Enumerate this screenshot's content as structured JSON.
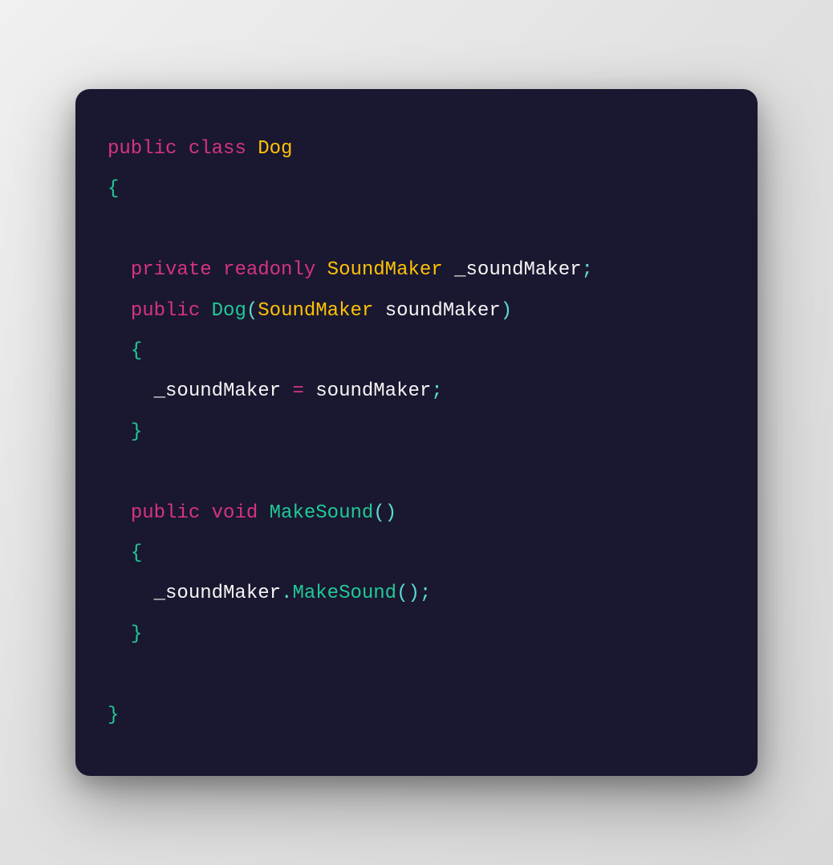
{
  "colors": {
    "background": "#1a1830",
    "keyword": "#d63384",
    "type": "#ffc107",
    "method": "#20c997",
    "brace": "#20c997",
    "punct": "#5cdbd3",
    "ident": "#f5f5f5"
  },
  "code": {
    "line1": {
      "kw_public": "public",
      "kw_class": "class",
      "type_dog": "Dog"
    },
    "line2": {
      "brace": "{"
    },
    "line3": {
      "spacer": ""
    },
    "line4": {
      "kw_private": "private",
      "kw_readonly": "readonly",
      "type_sm": "SoundMaker",
      "field": "_soundMaker",
      "semi": ";"
    },
    "line5": {
      "kw_public": "public",
      "ctor": "Dog",
      "lparen": "(",
      "param_type": "SoundMaker",
      "param_name": "soundMaker",
      "rparen": ")"
    },
    "line6": {
      "brace": "{"
    },
    "line7": {
      "lhs": "_soundMaker",
      "op": "=",
      "rhs": "soundMaker",
      "semi": ";"
    },
    "line8": {
      "brace": "}"
    },
    "line9": {
      "spacer": ""
    },
    "line10": {
      "kw_public": "public",
      "kw_void": "void",
      "method": "MakeSound",
      "lparen": "(",
      "rparen": ")"
    },
    "line11": {
      "brace": "{"
    },
    "line12": {
      "obj": "_soundMaker",
      "dot": ".",
      "call": "MakeSound",
      "lparen": "(",
      "rparen": ")",
      "semi": ";"
    },
    "line13": {
      "brace": "}"
    },
    "line14": {
      "spacer": ""
    },
    "line15": {
      "brace": "}"
    }
  }
}
